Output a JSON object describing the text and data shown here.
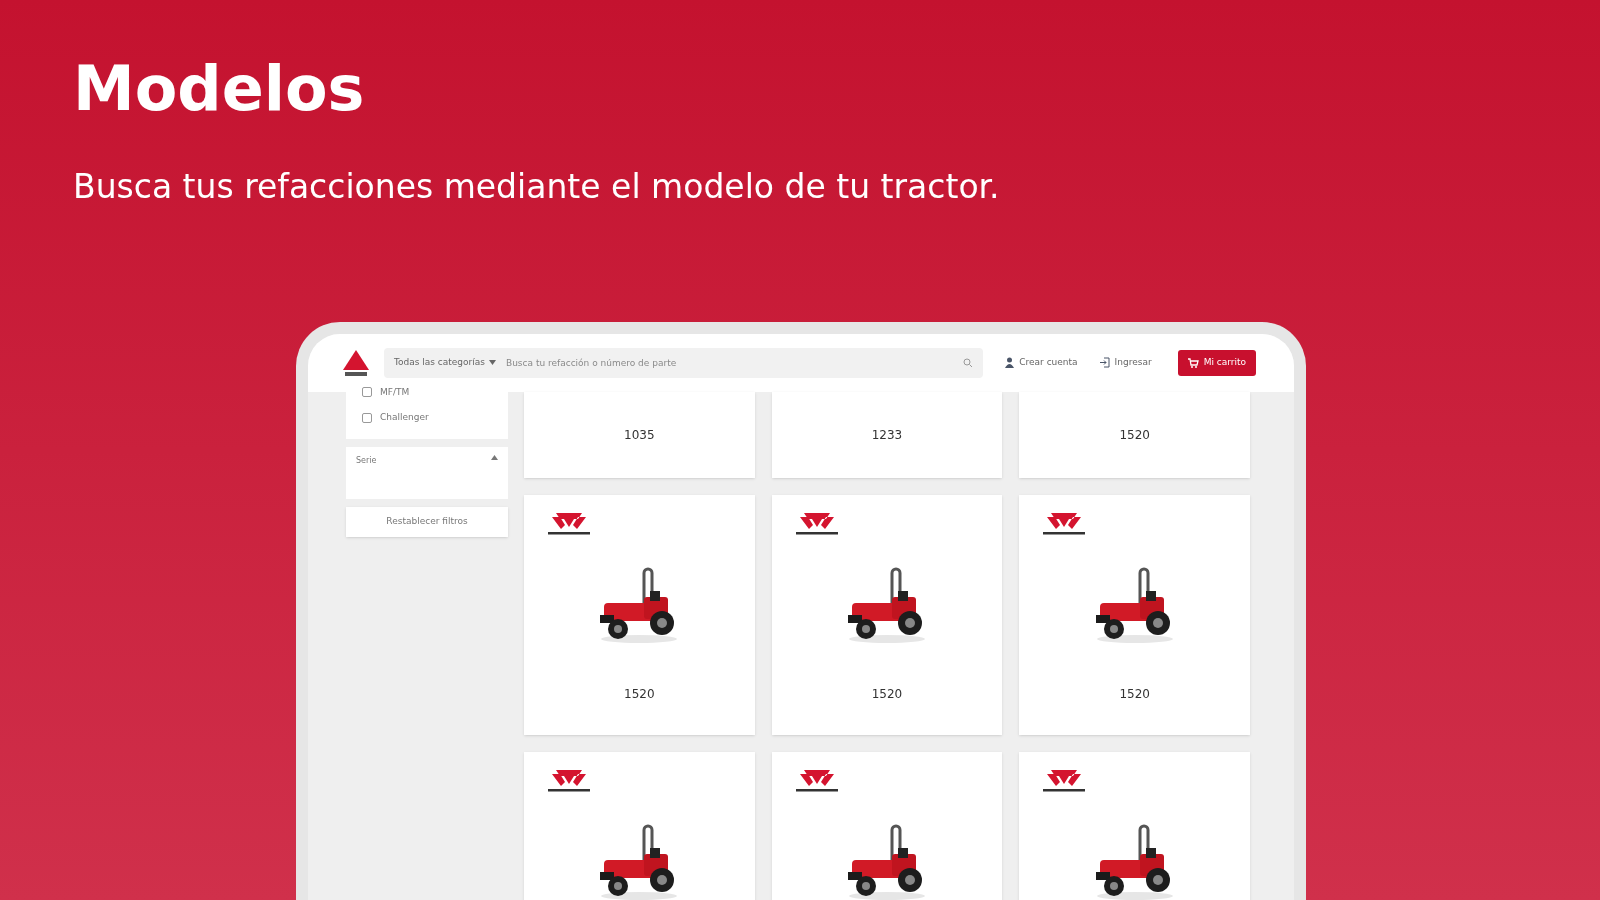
{
  "hero": {
    "title": "Modelos",
    "subtitle": "Busca tus refacciones mediante el modelo de tu tractor."
  },
  "header": {
    "category_select": "Todas las categorías",
    "search": {
      "placeholder": "Busca tu refacción o número de parte"
    },
    "links": [
      {
        "kind": "account",
        "label": "Crear cuenta"
      },
      {
        "kind": "login",
        "label": "Ingresar"
      }
    ],
    "cart_button": "Mi carrito"
  },
  "filters": {
    "brands": [
      {
        "label": "MF/TM",
        "checked": false
      },
      {
        "label": "Challenger",
        "checked": false
      }
    ],
    "section": {
      "title": "Serie",
      "expanded": true
    },
    "reset_button": "Restablecer filtros"
  },
  "models": [
    {
      "kind": "name_only",
      "name": "1035"
    },
    {
      "kind": "name_only",
      "name": "1233"
    },
    {
      "kind": "name_only",
      "name": "1520"
    },
    {
      "kind": "full",
      "name": "1520"
    },
    {
      "kind": "full",
      "name": "1520"
    },
    {
      "kind": "full",
      "name": "1520"
    },
    {
      "kind": "cut"
    },
    {
      "kind": "cut"
    },
    {
      "kind": "cut"
    }
  ]
}
